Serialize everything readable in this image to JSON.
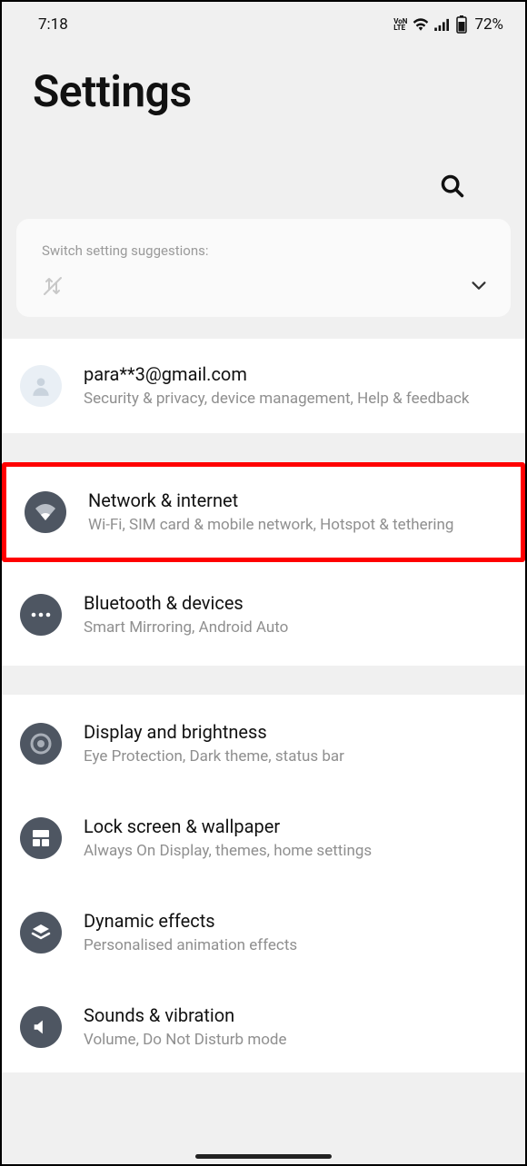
{
  "status": {
    "time": "7:18",
    "network_label": "VoLTE",
    "battery_pct": "72%"
  },
  "header": {
    "title": "Settings"
  },
  "suggestions": {
    "label": "Switch setting suggestions:"
  },
  "account": {
    "email": "para**3@gmail.com",
    "subtitle": "Security & privacy, device management, Help & feedback"
  },
  "groups": [
    {
      "items": [
        {
          "title": "Network & internet",
          "subtitle": "Wi-Fi, SIM card & mobile network, Hotspot & tethering",
          "highlighted": true
        },
        {
          "title": "Bluetooth & devices",
          "subtitle": "Smart Mirroring, Android Auto"
        }
      ]
    },
    {
      "items": [
        {
          "title": "Display and brightness",
          "subtitle": "Eye Protection, Dark theme, status bar"
        },
        {
          "title": "Lock screen & wallpaper",
          "subtitle": "Always On Display, themes, home settings"
        },
        {
          "title": "Dynamic effects",
          "subtitle": "Personalised animation effects"
        },
        {
          "title": "Sounds & vibration",
          "subtitle": "Volume, Do Not Disturb mode"
        }
      ]
    }
  ]
}
